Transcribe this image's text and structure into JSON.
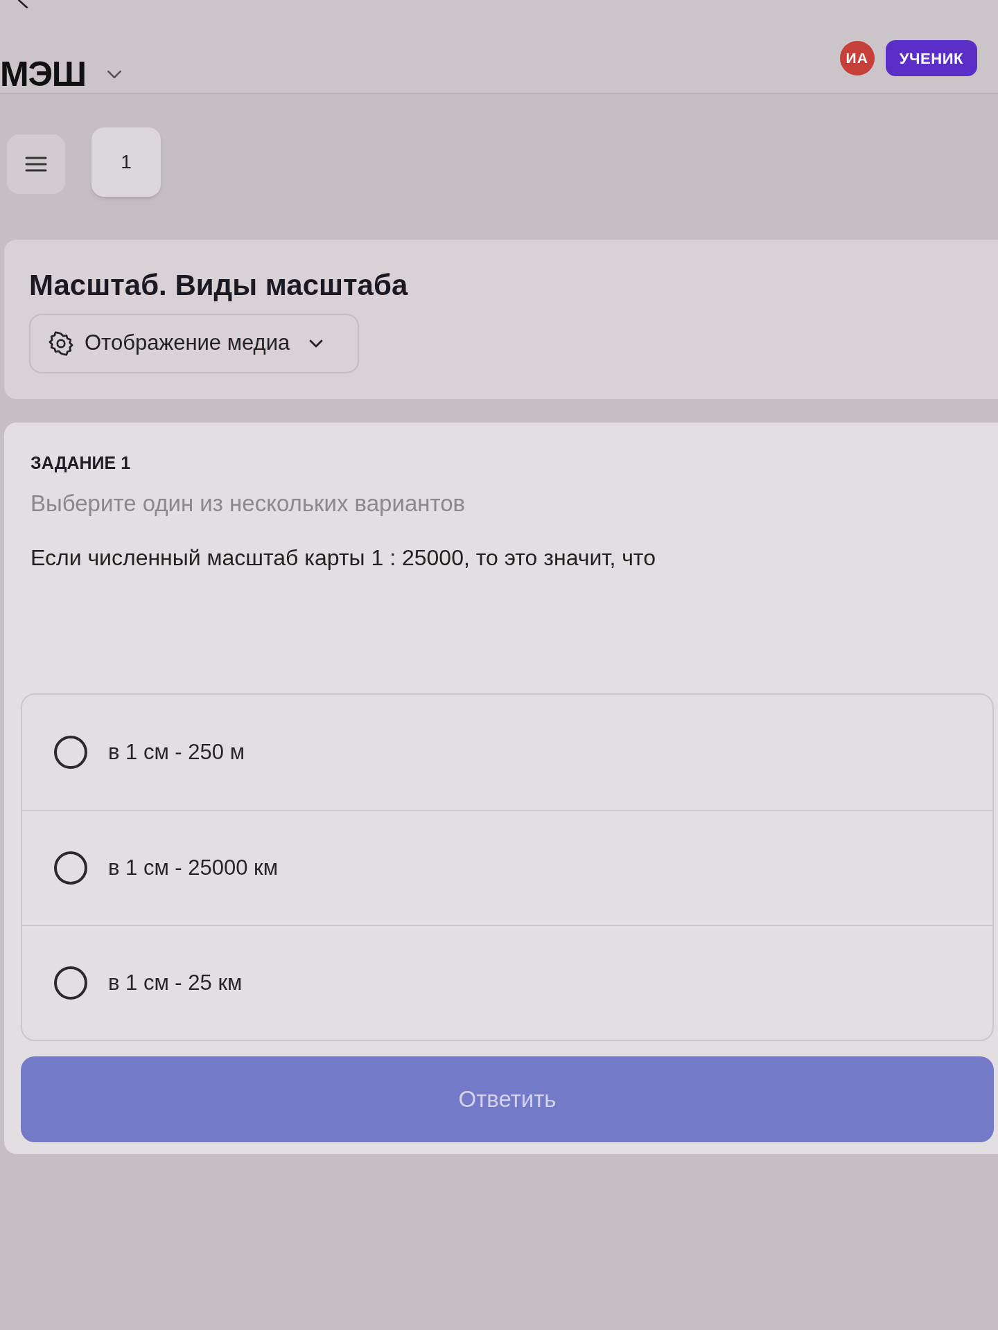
{
  "header": {
    "logo": "МЭШ",
    "avatar": {
      "initials": "ИА"
    },
    "role_badge": "УЧЕНИК"
  },
  "toolbar": {
    "task_numbers": [
      "1"
    ]
  },
  "lesson": {
    "title": "Масштаб. Виды масштаба",
    "media_button": "Отображение медиа"
  },
  "task": {
    "heading": "ЗАДАНИЕ 1",
    "instruction": "Выберите один из нескольких вариантов",
    "question": "Если численный масштаб карты 1 : 25000, то это значит, что",
    "options": [
      {
        "label": "в 1 см - 250 м",
        "selected": false
      },
      {
        "label": "в 1 см - 25000 км",
        "selected": false
      },
      {
        "label": "в 1 см - 25 км",
        "selected": false
      }
    ],
    "submit": {
      "label": "Ответить",
      "disabled": true
    }
  }
}
